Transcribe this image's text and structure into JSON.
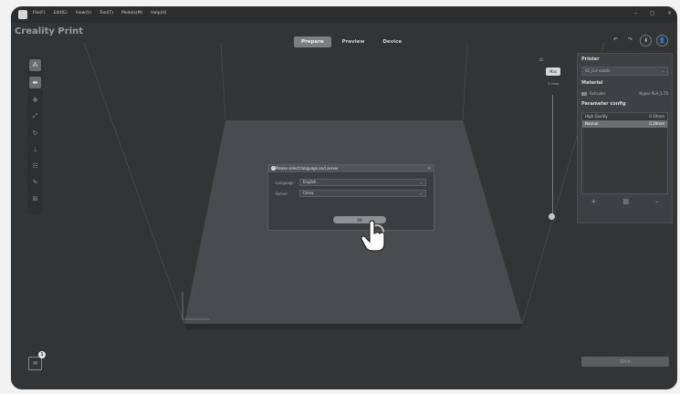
{
  "window": {
    "menu": [
      "File(F)",
      "Edit(E)",
      "View(V)",
      "Tool(T)",
      "Models(M)",
      "Help(H)"
    ],
    "controls": {
      "minimize": "–",
      "maximize": "◻",
      "close": "×"
    }
  },
  "header": {
    "brand": "Creality Print",
    "tabs": [
      {
        "label": "Prepare",
        "active": true
      },
      {
        "label": "Preview",
        "active": false
      },
      {
        "label": "Device",
        "active": false
      }
    ],
    "icons": {
      "undo": "↶",
      "redo": "↷",
      "download": "⬇",
      "user": "👤"
    }
  },
  "left_toolbar": {
    "icons": [
      "add-object-icon",
      "open-folder-icon",
      "move-icon",
      "scale-icon",
      "rotate-icon",
      "support-icon",
      "layout-icon",
      "paint-icon",
      "split-icon"
    ]
  },
  "right_panel": {
    "printer_title": "Printer",
    "printer_value": "K1_0.4 nozzle",
    "material_title": "Material",
    "material_slot": "Extruder",
    "material_value": "Hyper PLA_1.75",
    "param_title": "Parameter config",
    "profiles": [
      {
        "name": "High Quality",
        "value": "0.10mm",
        "selected": false
      },
      {
        "name": "Normal",
        "value": "0.20mm",
        "selected": true
      }
    ],
    "footer": [
      "+",
      "▤",
      "–"
    ]
  },
  "slice_button": "Slice",
  "layer_slider": {
    "top_label": "Max",
    "sub_label": "0.0mm"
  },
  "dialog": {
    "title": "Please select language and server",
    "close": "×",
    "language_label": "Language",
    "language_value": "English",
    "server_label": "Server",
    "server_value": "China",
    "ok_label": "OK"
  },
  "notification_count": "1",
  "colors": {
    "window_bg": "#333436",
    "accent": "#7d7e81"
  }
}
